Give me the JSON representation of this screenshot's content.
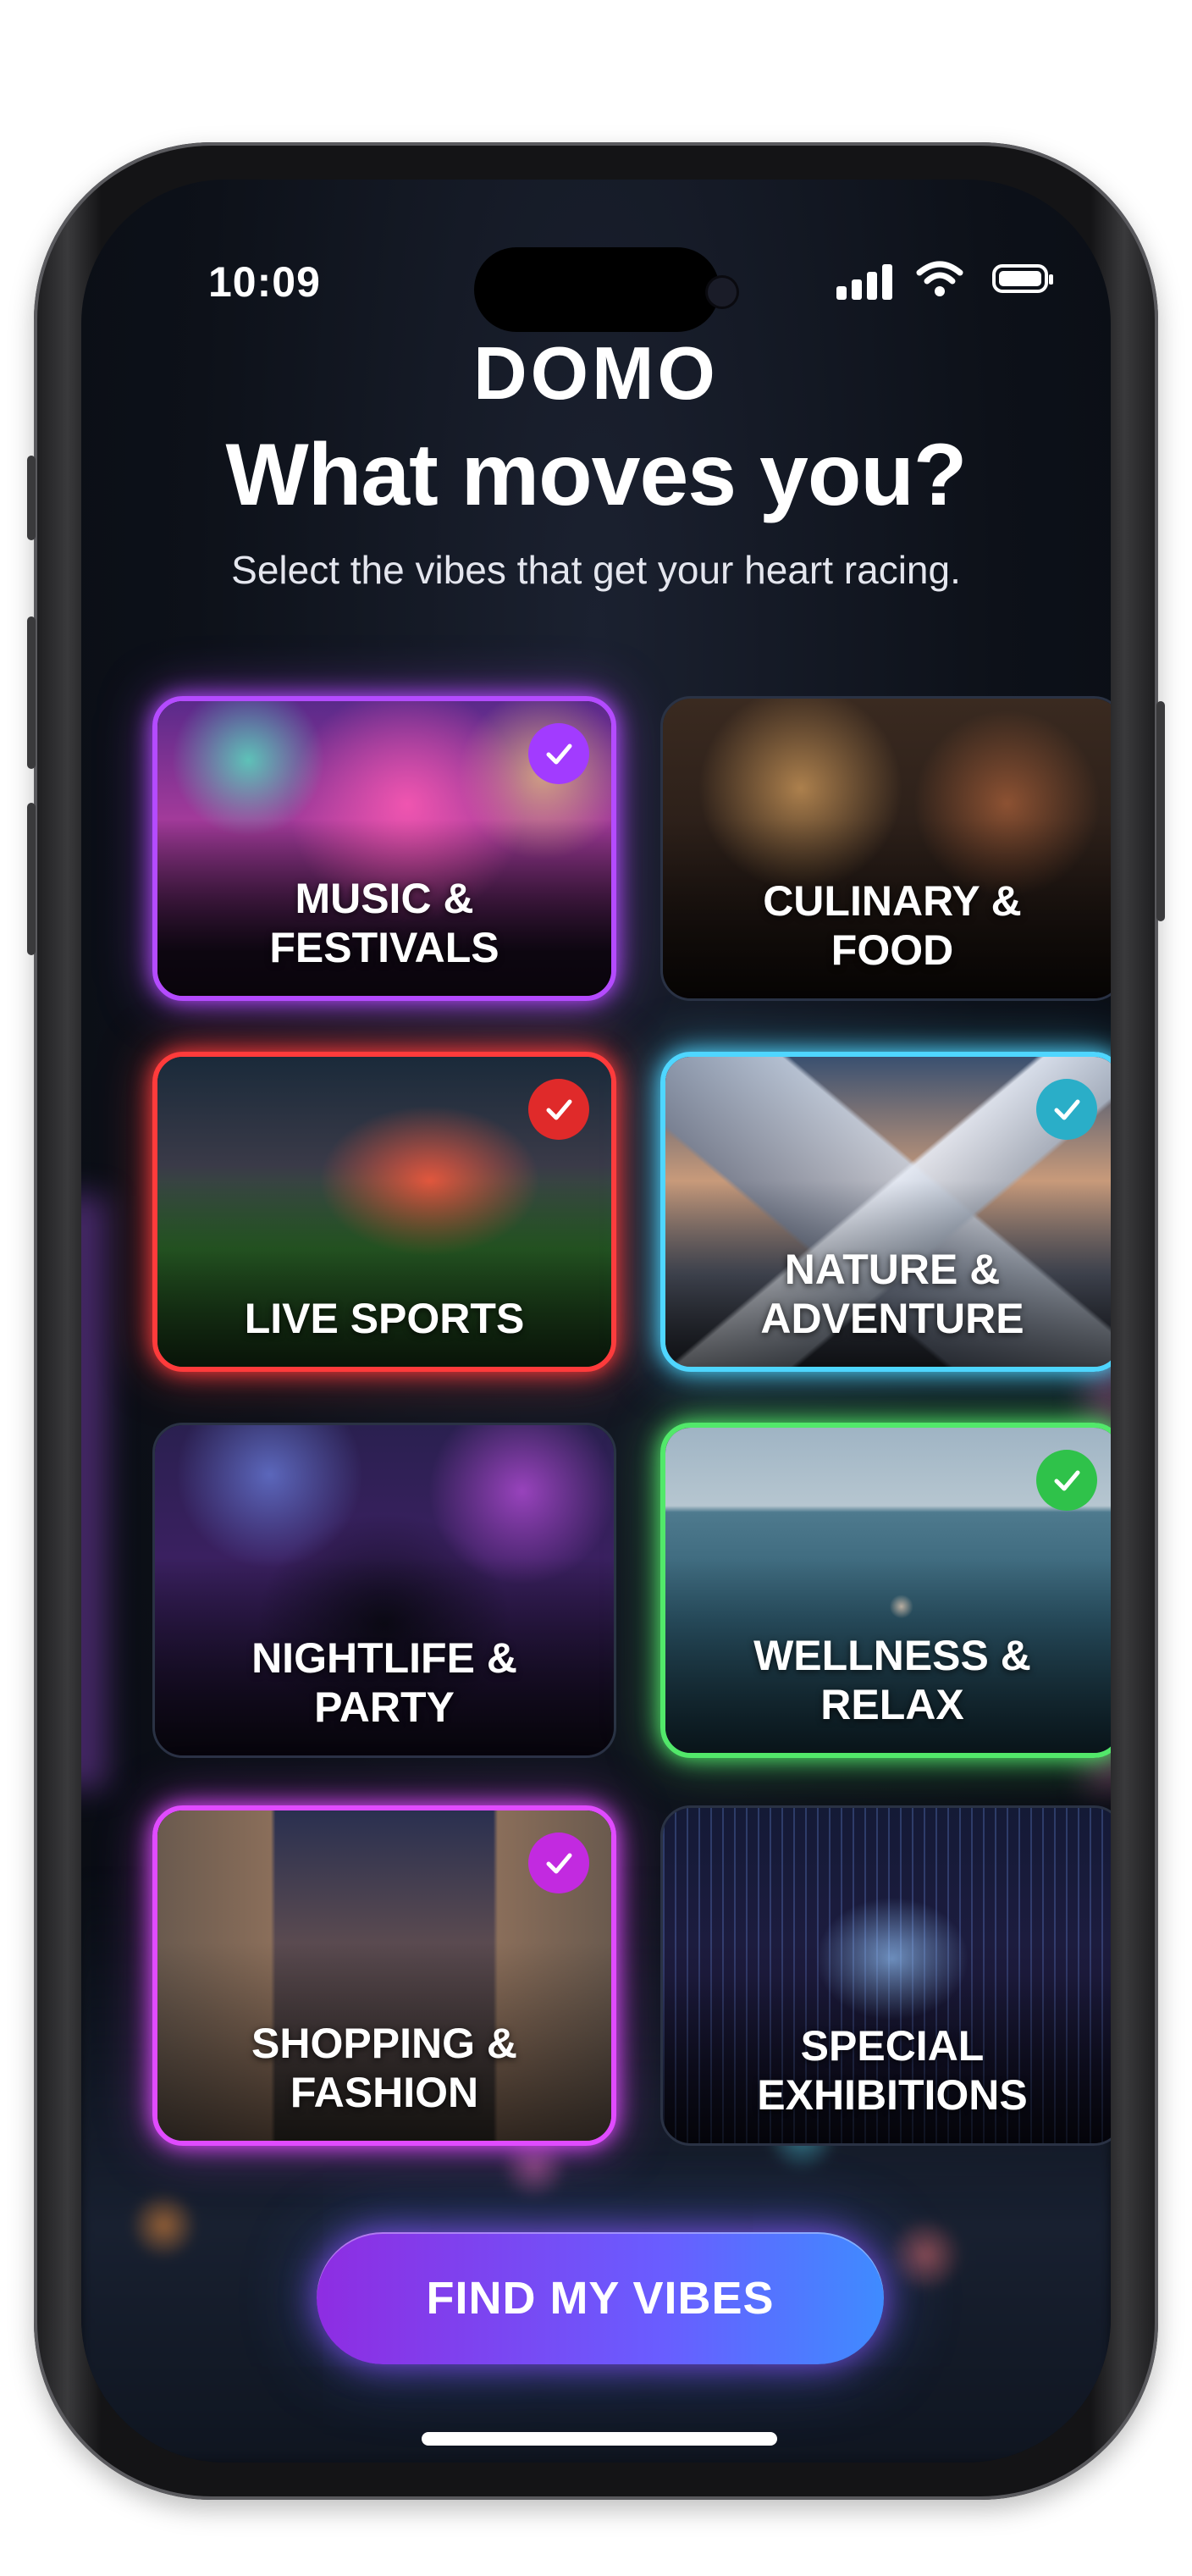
{
  "status_bar": {
    "time": "10:09"
  },
  "header": {
    "logo": "DOMO",
    "title": "What moves you?",
    "subtitle": "Select the vibes that get your heart racing."
  },
  "categories": [
    {
      "line1": "MUSIC &",
      "line2": "FESTIVALS",
      "selected": true,
      "accent": "#b44bff"
    },
    {
      "line1": "CULINARY &",
      "line2": "FOOD",
      "selected": false,
      "accent": "#2a3244"
    },
    {
      "line1": "LIVE SPORTS",
      "line2": "",
      "selected": true,
      "accent": "#ff3b3b"
    },
    {
      "line1": "NATURE &",
      "line2": "ADVENTURE",
      "selected": true,
      "accent": "#4fd6ff"
    },
    {
      "line1": "NIGHTLIFE &",
      "line2": "PARTY",
      "selected": false,
      "accent": "#2a3244"
    },
    {
      "line1": "WELLNESS &",
      "line2": "RELAX",
      "selected": true,
      "accent": "#52e86a"
    },
    {
      "line1": "SHOPPING &",
      "line2": "FASHION",
      "selected": true,
      "accent": "#e04bff"
    },
    {
      "line1": "SPECIAL",
      "line2": "EXHIBITIONS",
      "selected": false,
      "accent": "#2a3244"
    }
  ],
  "cta": {
    "label": "FIND MY VIBES"
  },
  "icons": {
    "selected_check": "checkmark-icon",
    "signal": "cellular-signal-icon",
    "wifi": "wifi-icon",
    "battery": "battery-icon"
  }
}
